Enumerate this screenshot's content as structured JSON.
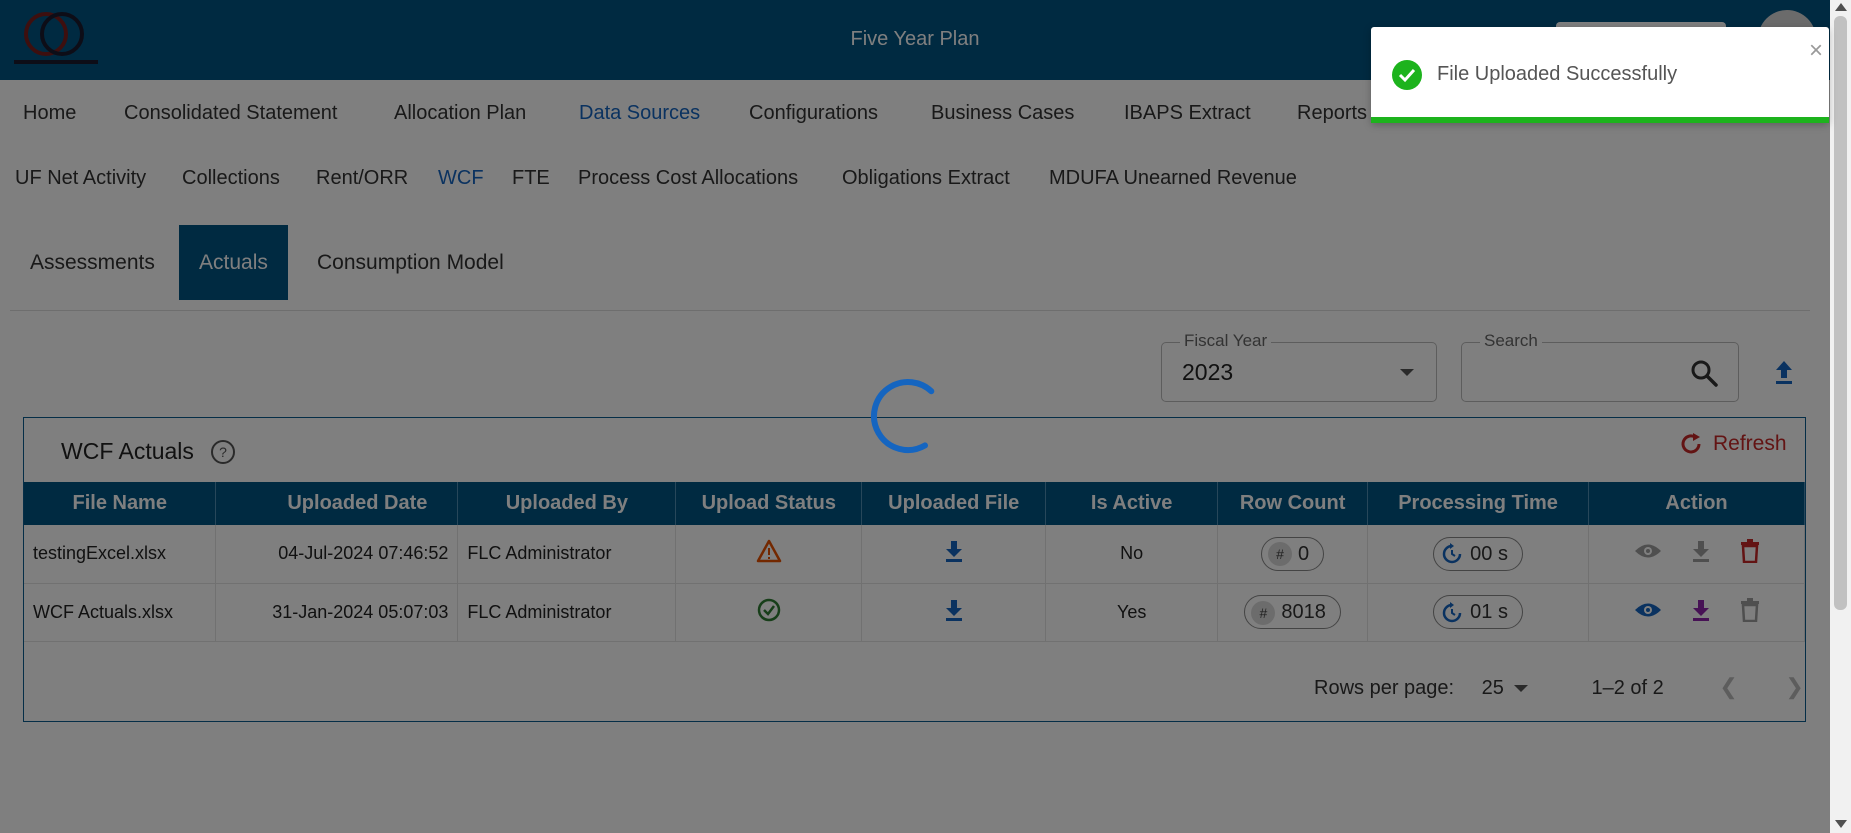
{
  "header": {
    "title": "Five Year Plan"
  },
  "nav": {
    "main": [
      "Home",
      "Consolidated Statement",
      "Allocation Plan",
      "Data Sources",
      "Configurations",
      "Business Cases",
      "IBAPS Extract",
      "Reports"
    ],
    "sub": [
      "UF Net Activity",
      "Collections",
      "Rent/ORR",
      "WCF",
      "FTE",
      "Process Cost Allocations",
      "Obligations Extract",
      "MDUFA Unearned Revenue"
    ]
  },
  "tabs": [
    "Assessments",
    "Actuals",
    "Consumption Model"
  ],
  "filters": {
    "fiscal_year_label": "Fiscal Year",
    "fiscal_year_value": "2023",
    "search_label": "Search"
  },
  "card": {
    "title": "WCF Actuals",
    "refresh_label": "Refresh"
  },
  "table": {
    "columns": [
      "File Name",
      "Uploaded Date",
      "Uploaded By",
      "Upload Status",
      "Uploaded File",
      "Is Active",
      "Row Count",
      "Processing Time",
      "Action"
    ],
    "rows": [
      {
        "file_name": "testingExcel.xlsx",
        "uploaded_date": "04-Jul-2024 07:46:52",
        "uploaded_by": "FLC Administrator",
        "upload_status": "warning-icon",
        "is_active": "No",
        "row_count": "0",
        "processing_time": "00 s"
      },
      {
        "file_name": "WCF Actuals.xlsx",
        "uploaded_date": "31-Jan-2024 05:07:03",
        "uploaded_by": "FLC Administrator",
        "upload_status": "check-circle-icon",
        "is_active": "Yes",
        "row_count": "8018",
        "processing_time": "01 s"
      }
    ]
  },
  "pagination": {
    "rows_per_page_label": "Rows per page:",
    "rows_per_page_value": "25",
    "range": "1–2 of 2"
  },
  "toast": {
    "message": "File Uploaded Successfully"
  },
  "colors": {
    "header": "#005483",
    "active_link": "#1565c0",
    "refresh": "#c62828",
    "toast_bar": "#1db31d"
  }
}
